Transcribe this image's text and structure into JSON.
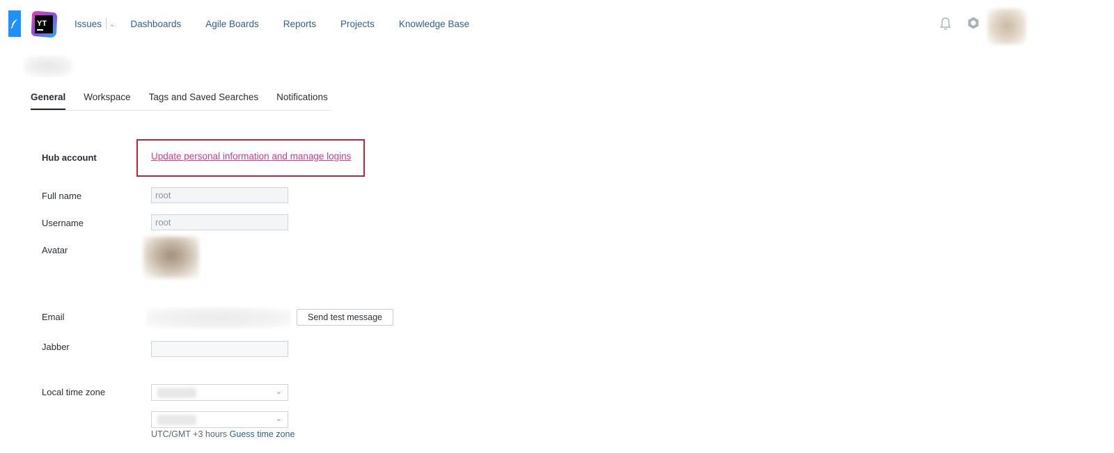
{
  "nav": {
    "items": [
      "Issues",
      "Dashboards",
      "Agile Boards",
      "Reports",
      "Projects",
      "Knowledge Base"
    ]
  },
  "logo": {
    "text": "YT"
  },
  "tabs": [
    "General",
    "Workspace",
    "Tags and Saved Searches",
    "Notifications"
  ],
  "form": {
    "hub_account_label": "Hub account",
    "hub_account_link": "Update personal information and manage logins",
    "full_name_label": "Full name",
    "full_name_value": "root",
    "username_label": "Username",
    "username_value": "root",
    "avatar_label": "Avatar",
    "email_label": "Email",
    "send_test_label": "Send test message",
    "jabber_label": "Jabber",
    "jabber_value": "",
    "timezone_label": "Local time zone",
    "timezone_offset": "UTC/GMT +3 hours",
    "guess_timezone": "Guess time zone"
  },
  "colors": {
    "link": "#2f5f93",
    "highlight_border": "#b3263b",
    "hub_link": "#d63a8c",
    "feather_strip": "#1e90ff"
  }
}
